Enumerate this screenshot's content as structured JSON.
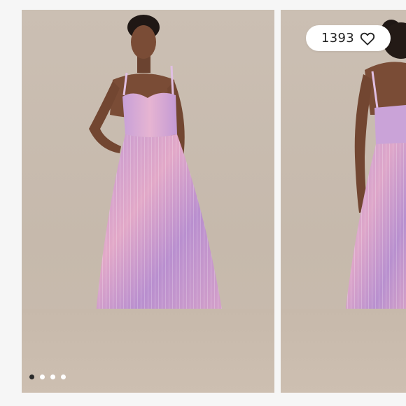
{
  "listing": {
    "likes_count": "1393",
    "like_icon": "heart-outline-icon",
    "image_count": 4,
    "active_image_index": 0
  },
  "colors": {
    "backdrop": "#c8bbae",
    "dress_lilac": "#b98fc8",
    "dress_pink": "#e2a7c4",
    "dot_active": "#2a2a2a",
    "dot_inactive": "#ffffff"
  }
}
